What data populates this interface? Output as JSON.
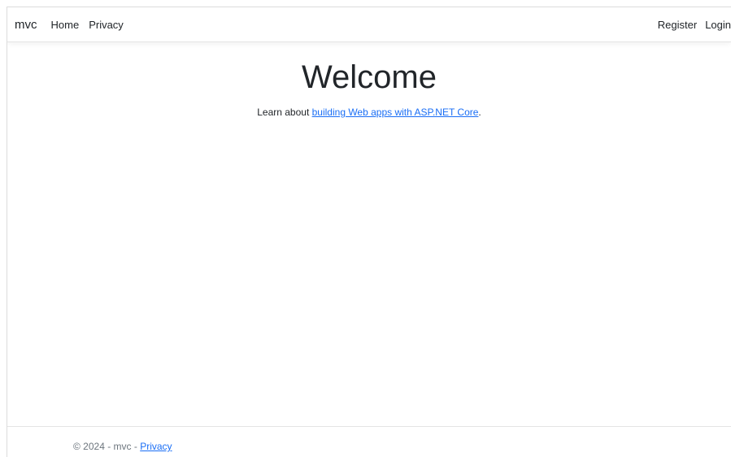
{
  "navbar": {
    "brand": "mvc",
    "links": [
      "Home",
      "Privacy"
    ],
    "right_links": [
      "Register",
      "Login"
    ]
  },
  "main": {
    "title": "Welcome",
    "lead_prefix": "Learn about ",
    "lead_link": "building Web apps with ASP.NET Core",
    "lead_suffix": "."
  },
  "footer": {
    "text": "© 2024 - mvc - ",
    "privacy_link": "Privacy"
  },
  "colors": {
    "link": "#1a6ef5",
    "text": "#212529",
    "muted": "#6c757d"
  }
}
